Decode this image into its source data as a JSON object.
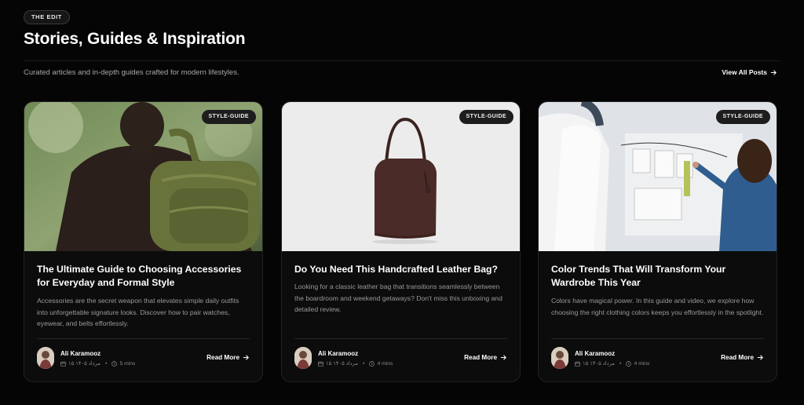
{
  "header": {
    "badge": "THE EDIT",
    "title": "Stories, Guides & Inspiration",
    "subtitle": "Curated articles and in-depth guides crafted for modern lifestyles.",
    "view_all": "View All Posts"
  },
  "cards": [
    {
      "tag": "STYLE-GUIDE",
      "title": "The Ultimate Guide to Choosing Accessories for Everyday and Formal Style",
      "excerpt": "Accessories are the secret weapon that elevates simple daily outfits into unforgettable signature looks. Discover how to pair watches, eyewear, and belts effortlessly.",
      "author": "Ali Karamooz",
      "date": "۱۵ مرداد ۱۴۰۵",
      "read_time": "5 mins",
      "read_more": "Read More"
    },
    {
      "tag": "STYLE-GUIDE",
      "title": "Do You Need This Handcrafted Leather Bag?",
      "excerpt": "Looking for a classic leather bag that transitions seamlessly between the boardroom and weekend getaways? Don't miss this unboxing and detailed review.",
      "author": "Ali Karamooz",
      "date": "۱۵ مرداد ۱۴۰۵",
      "read_time": "4 mins",
      "read_more": "Read More"
    },
    {
      "tag": "STYLE-GUIDE",
      "title": "Color Trends That Will Transform Your Wardrobe This Year",
      "excerpt": "Colors have magical power. In this guide and video, we explore how choosing the right clothing colors keeps you effortlessly in the spotlight.",
      "author": "Ali Karamooz",
      "date": "۱۵ مرداد ۱۴۰۵",
      "read_time": "4 mins",
      "read_more": "Read More"
    }
  ],
  "colors": {
    "background": "#050505",
    "card": "#0c0c0c",
    "text_muted": "#9a9a9a"
  },
  "icons": [
    "arrow-right-icon",
    "calendar-icon",
    "clock-icon"
  ]
}
